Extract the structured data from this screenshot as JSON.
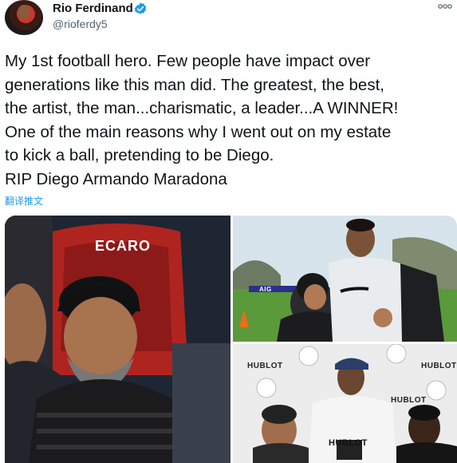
{
  "tweet": {
    "display_name": "Rio Ferdinand",
    "handle": "@rioferdy5",
    "lines": [
      "My 1st football hero. Few people have impact over",
      "generations like this man did. The greatest, the best,",
      "the artist, the man...charismatic, a leader...A WINNER!",
      "One of the main reasons why I went out on my estate",
      "to kick a ball, pretending to be Diego.",
      "RIP Diego Armando Maradona"
    ],
    "translate_label": "翻译推文"
  },
  "media": {
    "left_photo_text": "ECARO",
    "bottom_right_text": "HUBLOT",
    "top_right_banner": "AIG"
  },
  "icons": {
    "avatar": "profile-photo",
    "verified": "verified-badge-icon",
    "more": "more-options-icon"
  },
  "colors": {
    "link": "#1d9bf0",
    "text": "#0f1419",
    "secondary": "#536471"
  }
}
